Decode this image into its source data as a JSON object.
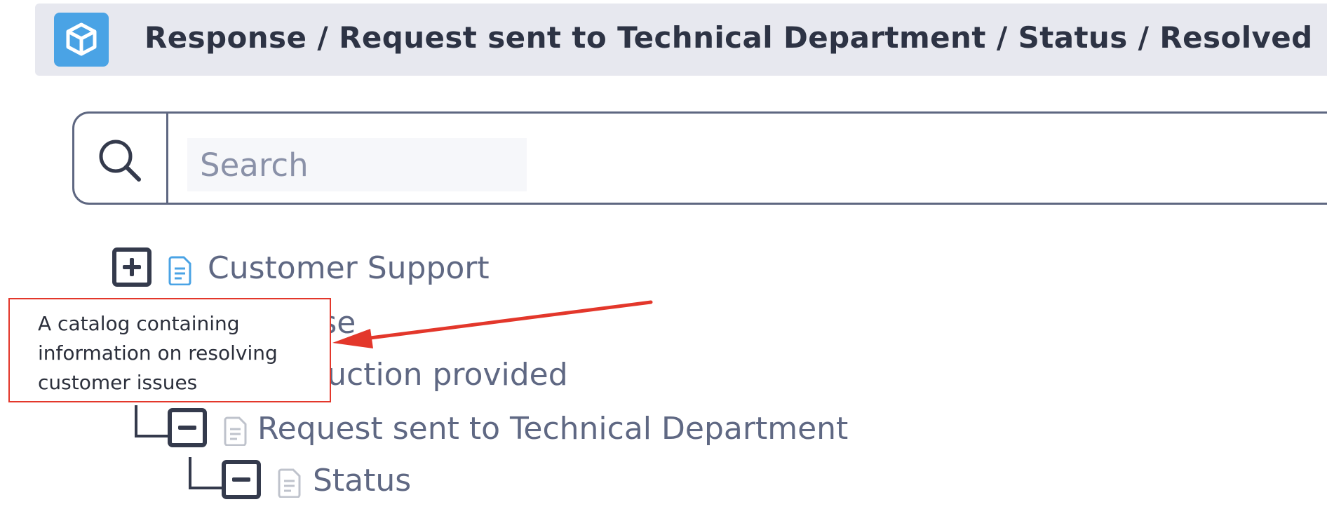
{
  "header": {
    "logo_icon": "cube-icon",
    "breadcrumb": "Response / Request sent to Technical Department / Status / Resolved"
  },
  "search": {
    "icon": "search-icon",
    "placeholder": "Search",
    "value": ""
  },
  "tree": {
    "nodes": [
      {
        "label": "Customer Support",
        "toggle": "plus",
        "icon": "document-icon",
        "icon_color": "#4aa3e5"
      },
      {
        "label": "Response",
        "toggle": "minus",
        "icon": "document-icon",
        "icon_color": "#bfc3cc"
      },
      {
        "label": "Instruction provided",
        "toggle": "minus",
        "icon": "document-icon",
        "icon_color": "#bfc3cc"
      },
      {
        "label": "Request sent to Technical Department",
        "toggle": "minus",
        "icon": "document-icon",
        "icon_color": "#bfc3cc"
      },
      {
        "label": "Status",
        "toggle": "minus",
        "icon": "document-icon",
        "icon_color": "#bfc3cc"
      }
    ]
  },
  "annotation": {
    "text": "A catalog containing information on resolving customer issues",
    "border_color": "#e3372b"
  },
  "colors": {
    "header_bg": "#e7e8ef",
    "accent": "#4aa3e5",
    "text": "#5f6883",
    "title": "#2d3344"
  }
}
